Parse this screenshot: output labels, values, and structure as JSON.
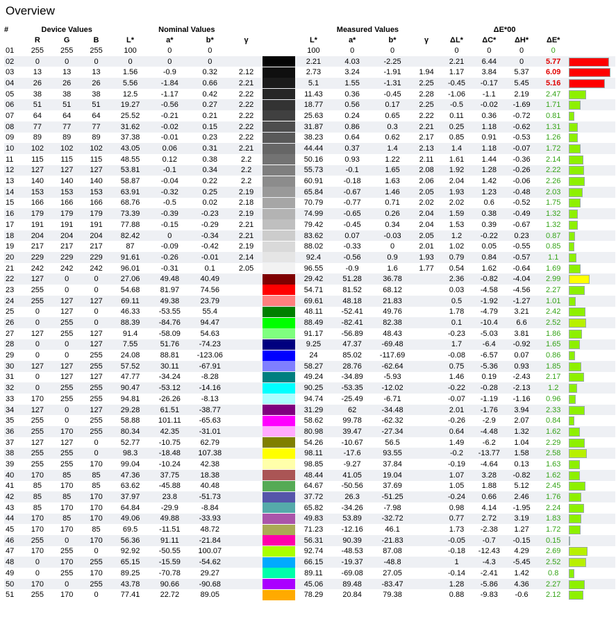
{
  "title": "Overview",
  "headers": {
    "index": "#",
    "group_device": "Device Values",
    "group_nominal": "Nominal Values",
    "group_measured": "Measured Values",
    "group_delta": "ΔE*00",
    "cols": [
      "R",
      "G",
      "B",
      "L*",
      "a*",
      "b*",
      "γ",
      "L*",
      "a*",
      "b*",
      "γ",
      "ΔL*",
      "ΔC*",
      "ΔH*",
      "ΔE*"
    ]
  },
  "rows": [
    [
      "01",
      "255",
      "255",
      "255",
      "100",
      "0",
      "0",
      "",
      "100",
      "0",
      "0",
      "",
      "0",
      "0",
      "0",
      "0",
      "#ffffff"
    ],
    [
      "02",
      "0",
      "0",
      "0",
      "0",
      "0",
      "0",
      "",
      "2.21",
      "4.03",
      "-2.25",
      "",
      "2.21",
      "6.44",
      "0",
      "5.77",
      "#050505"
    ],
    [
      "03",
      "13",
      "13",
      "13",
      "1.56",
      "-0.9",
      "0.32",
      "2.12",
      "2.73",
      "3.24",
      "-1.91",
      "1.94",
      "1.17",
      "3.84",
      "5.37",
      "6.09",
      "#0f0f0f"
    ],
    [
      "04",
      "26",
      "26",
      "26",
      "5.56",
      "-1.84",
      "0.66",
      "2.21",
      "5.1",
      "1.55",
      "-1.31",
      "2.25",
      "-0.45",
      "-0.17",
      "5.45",
      "5.16",
      "#1b1b1b"
    ],
    [
      "05",
      "38",
      "38",
      "38",
      "12.5",
      "-1.17",
      "0.42",
      "2.22",
      "11.43",
      "0.36",
      "-0.45",
      "2.28",
      "-1.06",
      "-1.1",
      "2.19",
      "2.47",
      "#262626"
    ],
    [
      "06",
      "51",
      "51",
      "51",
      "19.27",
      "-0.56",
      "0.27",
      "2.22",
      "18.77",
      "0.56",
      "0.17",
      "2.25",
      "-0.5",
      "-0.02",
      "-1.69",
      "1.71",
      "#333333"
    ],
    [
      "07",
      "64",
      "64",
      "64",
      "25.52",
      "-0.21",
      "0.21",
      "2.22",
      "25.63",
      "0.24",
      "0.65",
      "2.22",
      "0.11",
      "0.36",
      "-0.72",
      "0.81",
      "#404040"
    ],
    [
      "08",
      "77",
      "77",
      "77",
      "31.62",
      "-0.02",
      "0.15",
      "2.22",
      "31.87",
      "0.86",
      "0.3",
      "2.21",
      "0.25",
      "1.18",
      "-0.62",
      "1.31",
      "#4d4d4d"
    ],
    [
      "09",
      "89",
      "89",
      "89",
      "37.38",
      "-0.01",
      "0.23",
      "2.22",
      "38.23",
      "0.64",
      "0.62",
      "2.17",
      "0.85",
      "0.91",
      "-0.53",
      "1.26",
      "#595959"
    ],
    [
      "10",
      "102",
      "102",
      "102",
      "43.05",
      "0.06",
      "0.31",
      "2.21",
      "44.44",
      "0.37",
      "1.4",
      "2.13",
      "1.4",
      "1.18",
      "-0.07",
      "1.72",
      "#666666"
    ],
    [
      "11",
      "115",
      "115",
      "115",
      "48.55",
      "0.12",
      "0.38",
      "2.2",
      "50.16",
      "0.93",
      "1.22",
      "2.11",
      "1.61",
      "1.44",
      "-0.36",
      "2.14",
      "#737373"
    ],
    [
      "12",
      "127",
      "127",
      "127",
      "53.81",
      "-0.1",
      "0.34",
      "2.2",
      "55.73",
      "-0.1",
      "1.65",
      "2.08",
      "1.92",
      "1.28",
      "-0.26",
      "2.22",
      "#7f7f7f"
    ],
    [
      "13",
      "140",
      "140",
      "140",
      "58.87",
      "-0.04",
      "0.22",
      "2.2",
      "60.91",
      "-0.18",
      "1.63",
      "2.06",
      "2.04",
      "1.42",
      "-0.06",
      "2.26",
      "#8c8c8c"
    ],
    [
      "14",
      "153",
      "153",
      "153",
      "63.91",
      "-0.32",
      "0.25",
      "2.19",
      "65.84",
      "-0.67",
      "1.46",
      "2.05",
      "1.93",
      "1.23",
      "-0.48",
      "2.03",
      "#999999"
    ],
    [
      "15",
      "166",
      "166",
      "166",
      "68.76",
      "-0.5",
      "0.02",
      "2.18",
      "70.79",
      "-0.77",
      "0.71",
      "2.02",
      "2.02",
      "0.6",
      "-0.52",
      "1.75",
      "#a6a6a6"
    ],
    [
      "16",
      "179",
      "179",
      "179",
      "73.39",
      "-0.39",
      "-0.23",
      "2.19",
      "74.99",
      "-0.65",
      "0.26",
      "2.04",
      "1.59",
      "0.38",
      "-0.49",
      "1.32",
      "#b3b3b3"
    ],
    [
      "17",
      "191",
      "191",
      "191",
      "77.88",
      "-0.15",
      "-0.29",
      "2.21",
      "79.42",
      "-0.45",
      "0.34",
      "2.04",
      "1.53",
      "0.39",
      "-0.67",
      "1.32",
      "#bfbfbf"
    ],
    [
      "18",
      "204",
      "204",
      "204",
      "82.42",
      "0",
      "-0.34",
      "2.21",
      "83.62",
      "0.07",
      "-0.03",
      "2.05",
      "1.2",
      "-0.22",
      "0.23",
      "0.87",
      "#cccccc"
    ],
    [
      "19",
      "217",
      "217",
      "217",
      "87",
      "-0.09",
      "-0.42",
      "2.19",
      "88.02",
      "-0.33",
      "0",
      "2.01",
      "1.02",
      "0.05",
      "-0.55",
      "0.85",
      "#d9d9d9"
    ],
    [
      "20",
      "229",
      "229",
      "229",
      "91.61",
      "-0.26",
      "-0.01",
      "2.14",
      "92.4",
      "-0.56",
      "0.9",
      "1.93",
      "0.79",
      "0.84",
      "-0.57",
      "1.1",
      "#e5e5e5"
    ],
    [
      "21",
      "242",
      "242",
      "242",
      "96.01",
      "-0.31",
      "0.1",
      "2.05",
      "96.55",
      "-0.9",
      "1.6",
      "1.77",
      "0.54",
      "1.62",
      "-0.64",
      "1.69",
      "#f2f2f2"
    ],
    [
      "22",
      "127",
      "0",
      "0",
      "27.06",
      "49.48",
      "40.49",
      "",
      "29.42",
      "51.28",
      "36.78",
      "",
      "2.36",
      "-0.82",
      "-4.04",
      "2.99",
      "#7f0000"
    ],
    [
      "23",
      "255",
      "0",
      "0",
      "54.68",
      "81.97",
      "74.56",
      "",
      "54.71",
      "81.52",
      "68.12",
      "",
      "0.03",
      "-4.58",
      "-4.56",
      "2.27",
      "#ff0000"
    ],
    [
      "24",
      "255",
      "127",
      "127",
      "69.11",
      "49.38",
      "23.79",
      "",
      "69.61",
      "48.18",
      "21.83",
      "",
      "0.5",
      "-1.92",
      "-1.27",
      "1.01",
      "#ff7f7f"
    ],
    [
      "25",
      "0",
      "127",
      "0",
      "46.33",
      "-53.55",
      "55.4",
      "",
      "48.11",
      "-52.41",
      "49.76",
      "",
      "1.78",
      "-4.79",
      "3.21",
      "2.42",
      "#007f00"
    ],
    [
      "26",
      "0",
      "255",
      "0",
      "88.39",
      "-84.76",
      "94.47",
      "",
      "88.49",
      "-82.41",
      "82.38",
      "",
      "0.1",
      "-10.4",
      "6.6",
      "2.52",
      "#00ff00"
    ],
    [
      "27",
      "127",
      "255",
      "127",
      "91.4",
      "-58.09",
      "54.63",
      "",
      "91.17",
      "-56.89",
      "48.43",
      "",
      "-0.23",
      "-5.03",
      "3.81",
      "1.86",
      "#7fff7f"
    ],
    [
      "28",
      "0",
      "0",
      "127",
      "7.55",
      "51.76",
      "-74.23",
      "",
      "9.25",
      "47.37",
      "-69.48",
      "",
      "1.7",
      "-6.4",
      "-0.92",
      "1.65",
      "#00007f"
    ],
    [
      "29",
      "0",
      "0",
      "255",
      "24.08",
      "88.81",
      "-123.06",
      "",
      "24",
      "85.02",
      "-117.69",
      "",
      "-0.08",
      "-6.57",
      "0.07",
      "0.86",
      "#0000ff"
    ],
    [
      "30",
      "127",
      "127",
      "255",
      "57.52",
      "30.11",
      "-67.91",
      "",
      "58.27",
      "28.76",
      "-62.64",
      "",
      "0.75",
      "-5.36",
      "0.93",
      "1.85",
      "#7f7fff"
    ],
    [
      "31",
      "0",
      "127",
      "127",
      "47.77",
      "-34.24",
      "-8.28",
      "",
      "49.24",
      "-34.89",
      "-5.93",
      "",
      "1.46",
      "0.19",
      "-2.43",
      "2.17",
      "#007f7f"
    ],
    [
      "32",
      "0",
      "255",
      "255",
      "90.47",
      "-53.12",
      "-14.16",
      "",
      "90.25",
      "-53.35",
      "-12.02",
      "",
      "-0.22",
      "-0.28",
      "-2.13",
      "1.2",
      "#00ffff"
    ],
    [
      "33",
      "170",
      "255",
      "255",
      "94.81",
      "-26.26",
      "-8.13",
      "",
      "94.74",
      "-25.49",
      "-6.71",
      "",
      "-0.07",
      "-1.19",
      "-1.16",
      "0.96",
      "#aaffff"
    ],
    [
      "34",
      "127",
      "0",
      "127",
      "29.28",
      "61.51",
      "-38.77",
      "",
      "31.29",
      "62",
      "-34.48",
      "",
      "2.01",
      "-1.76",
      "3.94",
      "2.33",
      "#7f007f"
    ],
    [
      "35",
      "255",
      "0",
      "255",
      "58.88",
      "101.11",
      "-65.63",
      "",
      "58.62",
      "99.78",
      "-62.32",
      "",
      "-0.26",
      "-2.9",
      "2.07",
      "0.84",
      "#ff00ff"
    ],
    [
      "36",
      "255",
      "170",
      "255",
      "80.34",
      "42.35",
      "-31.01",
      "",
      "80.98",
      "39.47",
      "-27.34",
      "",
      "0.64",
      "-4.48",
      "1.32",
      "1.62",
      "#ffaaff"
    ],
    [
      "37",
      "127",
      "127",
      "0",
      "52.77",
      "-10.75",
      "62.79",
      "",
      "54.26",
      "-10.67",
      "56.5",
      "",
      "1.49",
      "-6.2",
      "1.04",
      "2.29",
      "#7f7f00"
    ],
    [
      "38",
      "255",
      "255",
      "0",
      "98.3",
      "-18.48",
      "107.38",
      "",
      "98.11",
      "-17.6",
      "93.55",
      "",
      "-0.2",
      "-13.77",
      "1.58",
      "2.58",
      "#ffff00"
    ],
    [
      "39",
      "255",
      "255",
      "170",
      "99.04",
      "-10.24",
      "42.38",
      "",
      "98.85",
      "-9.27",
      "37.84",
      "",
      "-0.19",
      "-4.64",
      "0.13",
      "1.63",
      "#ffffaa"
    ],
    [
      "40",
      "170",
      "85",
      "85",
      "47.36",
      "37.75",
      "18.38",
      "",
      "48.44",
      "41.05",
      "19.04",
      "",
      "1.07",
      "3.28",
      "-0.82",
      "1.62",
      "#aa5555"
    ],
    [
      "41",
      "85",
      "170",
      "85",
      "63.62",
      "-45.88",
      "40.48",
      "",
      "64.67",
      "-50.56",
      "37.69",
      "",
      "1.05",
      "1.88",
      "5.12",
      "2.45",
      "#55aa55"
    ],
    [
      "42",
      "85",
      "85",
      "170",
      "37.97",
      "23.8",
      "-51.73",
      "",
      "37.72",
      "26.3",
      "-51.25",
      "",
      "-0.24",
      "0.66",
      "2.46",
      "1.76",
      "#5555aa"
    ],
    [
      "43",
      "85",
      "170",
      "170",
      "64.84",
      "-29.9",
      "-8.84",
      "",
      "65.82",
      "-34.26",
      "-7.98",
      "",
      "0.98",
      "4.14",
      "-1.95",
      "2.24",
      "#55aaaa"
    ],
    [
      "44",
      "170",
      "85",
      "170",
      "49.06",
      "49.88",
      "-33.93",
      "",
      "49.83",
      "53.89",
      "-32.72",
      "",
      "0.77",
      "2.72",
      "3.19",
      "1.83",
      "#aa55aa"
    ],
    [
      "45",
      "170",
      "170",
      "85",
      "69.5",
      "-11.51",
      "48.72",
      "",
      "71.23",
      "-12.16",
      "46.1",
      "",
      "1.73",
      "-2.38",
      "1.27",
      "1.72",
      "#aaaa55"
    ],
    [
      "46",
      "255",
      "0",
      "170",
      "56.36",
      "91.11",
      "-21.84",
      "",
      "56.31",
      "90.39",
      "-21.83",
      "",
      "-0.05",
      "-0.7",
      "-0.15",
      "0.15",
      "#ff00aa"
    ],
    [
      "47",
      "170",
      "255",
      "0",
      "92.92",
      "-50.55",
      "100.07",
      "",
      "92.74",
      "-48.53",
      "87.08",
      "",
      "-0.18",
      "-12.43",
      "4.29",
      "2.69",
      "#aaff00"
    ],
    [
      "48",
      "0",
      "170",
      "255",
      "65.15",
      "-15.59",
      "-54.62",
      "",
      "66.15",
      "-19.37",
      "-48.8",
      "",
      "1",
      "-4.3",
      "-5.45",
      "2.52",
      "#00aaff"
    ],
    [
      "49",
      "0",
      "255",
      "170",
      "89.25",
      "-70.78",
      "29.27",
      "",
      "89.11",
      "-69.08",
      "27.05",
      "",
      "-0.14",
      "-2.41",
      "1.42",
      "0.8",
      "#00ffaa"
    ],
    [
      "50",
      "170",
      "0",
      "255",
      "43.78",
      "90.66",
      "-90.68",
      "",
      "45.06",
      "89.48",
      "-83.47",
      "",
      "1.28",
      "-5.86",
      "4.36",
      "2.27",
      "#aa00ff"
    ],
    [
      "51",
      "255",
      "170",
      "0",
      "77.41",
      "22.72",
      "89.05",
      "",
      "78.29",
      "20.84",
      "79.38",
      "",
      "0.88",
      "-9.83",
      "-0.6",
      "2.12",
      "#ffaa00"
    ]
  ],
  "colors": {
    "bar_red": "#ff0000",
    "bar_yellow": "#ffff00",
    "bar_green": "#8ef000",
    "bar_lime": "#b8f000",
    "text_good": "#35a418",
    "text_bad": "#e00000"
  }
}
